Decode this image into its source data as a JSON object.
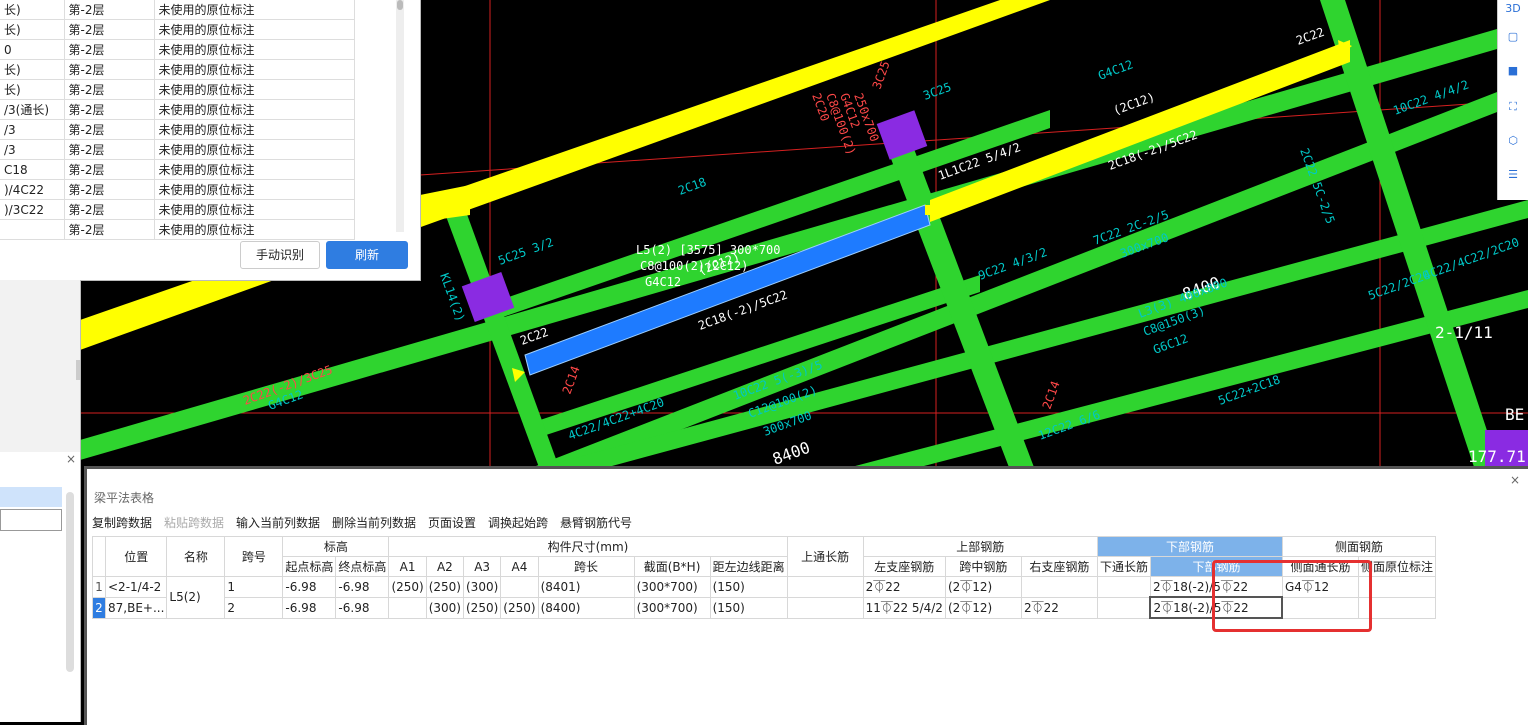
{
  "top_panel": {
    "rows": [
      {
        "name": "长)",
        "floor": "第-2层",
        "status": "未使用的原位标注"
      },
      {
        "name": "长)",
        "floor": "第-2层",
        "status": "未使用的原位标注"
      },
      {
        "name": "0",
        "floor": "第-2层",
        "status": "未使用的原位标注"
      },
      {
        "name": "长)",
        "floor": "第-2层",
        "status": "未使用的原位标注"
      },
      {
        "name": "长)",
        "floor": "第-2层",
        "status": "未使用的原位标注"
      },
      {
        "name": "/3(通长)",
        "floor": "第-2层",
        "status": "未使用的原位标注"
      },
      {
        "name": "/3",
        "floor": "第-2层",
        "status": "未使用的原位标注"
      },
      {
        "name": "/3",
        "floor": "第-2层",
        "status": "未使用的原位标注"
      },
      {
        "name": "C18",
        "floor": "第-2层",
        "status": "未使用的原位标注"
      },
      {
        "name": ")/4C22",
        "floor": "第-2层",
        "status": "未使用的原位标注"
      },
      {
        "name": ")/3C22",
        "floor": "第-2层",
        "status": "未使用的原位标注"
      },
      {
        "name": "",
        "floor": "第-2层",
        "status": "未使用的原位标注"
      }
    ],
    "manual_button": "手动识别",
    "refresh_button": "刷新"
  },
  "cad": {
    "labels": [
      "2C18",
      "3C25",
      "G4C12",
      "L5(2) [3575] 300*700",
      "C8@100(2)(2C12)",
      "G4C12",
      "(2C12)",
      "2C18(-2)/5C22",
      "2C22",
      "2C22(-2)/3C25",
      "G4C12",
      "5C25 3/2",
      "KL14(2)",
      "2C14",
      "4C22/4C22+4C20",
      "1L1C22 5/4/2",
      "2C18(-2)/5C22",
      "(2C12)",
      "2C22",
      "8400",
      "2-1/11",
      "BE",
      "177.71°",
      "2C14",
      "12C22 6/6",
      "9C22 4/3/2",
      "7C22 2C-2/5",
      "300x700",
      "L3(3) 400x800",
      "C8@150(3)",
      "G6C12",
      "5C22/2C20",
      "4C22/4C22/2C20",
      "10C22 5(-3)/5",
      "C12@100(2)",
      "300x700",
      "5C22+2C18",
      "2C22 5C-2/5",
      "8400",
      "3C25",
      "2C20",
      "C8@100(2)",
      "G4C12",
      "250x700",
      "10C22 4/4/2"
    ],
    "colors": {
      "beam_green": "#2fd42f",
      "beam_yellow": "#ffff00",
      "beam_blue": "#1e7bff",
      "axis_red": "#d42020",
      "text_cyan": "#00c8c8",
      "text_red": "#ff4848",
      "column_purple": "#8a2be2"
    }
  },
  "bottom_panel": {
    "title": "梁平法表格",
    "toolbar": [
      "复制跨数据",
      "粘贴跨数据",
      "输入当前列数据",
      "删除当前列数据",
      "页面设置",
      "调换起始跨",
      "悬臂钢筋代号"
    ],
    "toolbar_disabled": [
      false,
      true,
      false,
      false,
      false,
      false,
      false
    ],
    "headers_top": {
      "position": "位置",
      "name": "名称",
      "span": "跨号",
      "elevation": "标高",
      "dimensions": "构件尺寸(mm)",
      "top_through": "上通长筋",
      "top_rebar": "上部钢筋",
      "bottom_rebar": "下部钢筋",
      "side_rebar": "侧面钢筋"
    },
    "headers_sub": [
      "起点标高",
      "终点标高",
      "A1",
      "A2",
      "A3",
      "A4",
      "跨长",
      "截面(B*H)",
      "距左边线距离",
      "左支座钢筋",
      "跨中钢筋",
      "右支座钢筋",
      "下通长筋",
      "下部钢筋",
      "侧面通长筋",
      "侧面原位标注"
    ],
    "rows": [
      {
        "num": "1",
        "position": "<2-1/4-2",
        "name": "L5(2)",
        "span": "1",
        "start_elev": "-6.98",
        "end_elev": "-6.98",
        "a1": "(250)",
        "a2": "(250)",
        "a3": "(300)",
        "a4": "",
        "span_len": "(8401)",
        "section": "(300*700)",
        "left_dist": "(150)",
        "top_through": "",
        "left_support": "2⏁22",
        "mid": "(2⏁12)",
        "right_support": "",
        "bottom_through": "",
        "bottom": "2⏁18(-2)/5⏁22",
        "side_through": "G4⏁12",
        "side_orig": ""
      },
      {
        "num": "2",
        "position": "87,BE+...",
        "name": "",
        "span": "2",
        "start_elev": "-6.98",
        "end_elev": "-6.98",
        "a1": "",
        "a2": "(300)",
        "a3": "(250)",
        "a4": "(250)",
        "span_len": "(8400)",
        "section": "(300*700)",
        "left_dist": "(150)",
        "top_through": "",
        "left_support": "11⏁22 5/4/2",
        "mid": "(2⏁12)",
        "right_support": "2⏁22",
        "bottom_through": "",
        "bottom": "2⏁18(-2)/5⏁22",
        "side_through": "",
        "side_orig": ""
      }
    ]
  },
  "right_toolbar": [
    "3d-icon",
    "cube-front-icon",
    "cube-top-icon",
    "fit-view-icon",
    "cube-outline-icon",
    "report-icon"
  ]
}
